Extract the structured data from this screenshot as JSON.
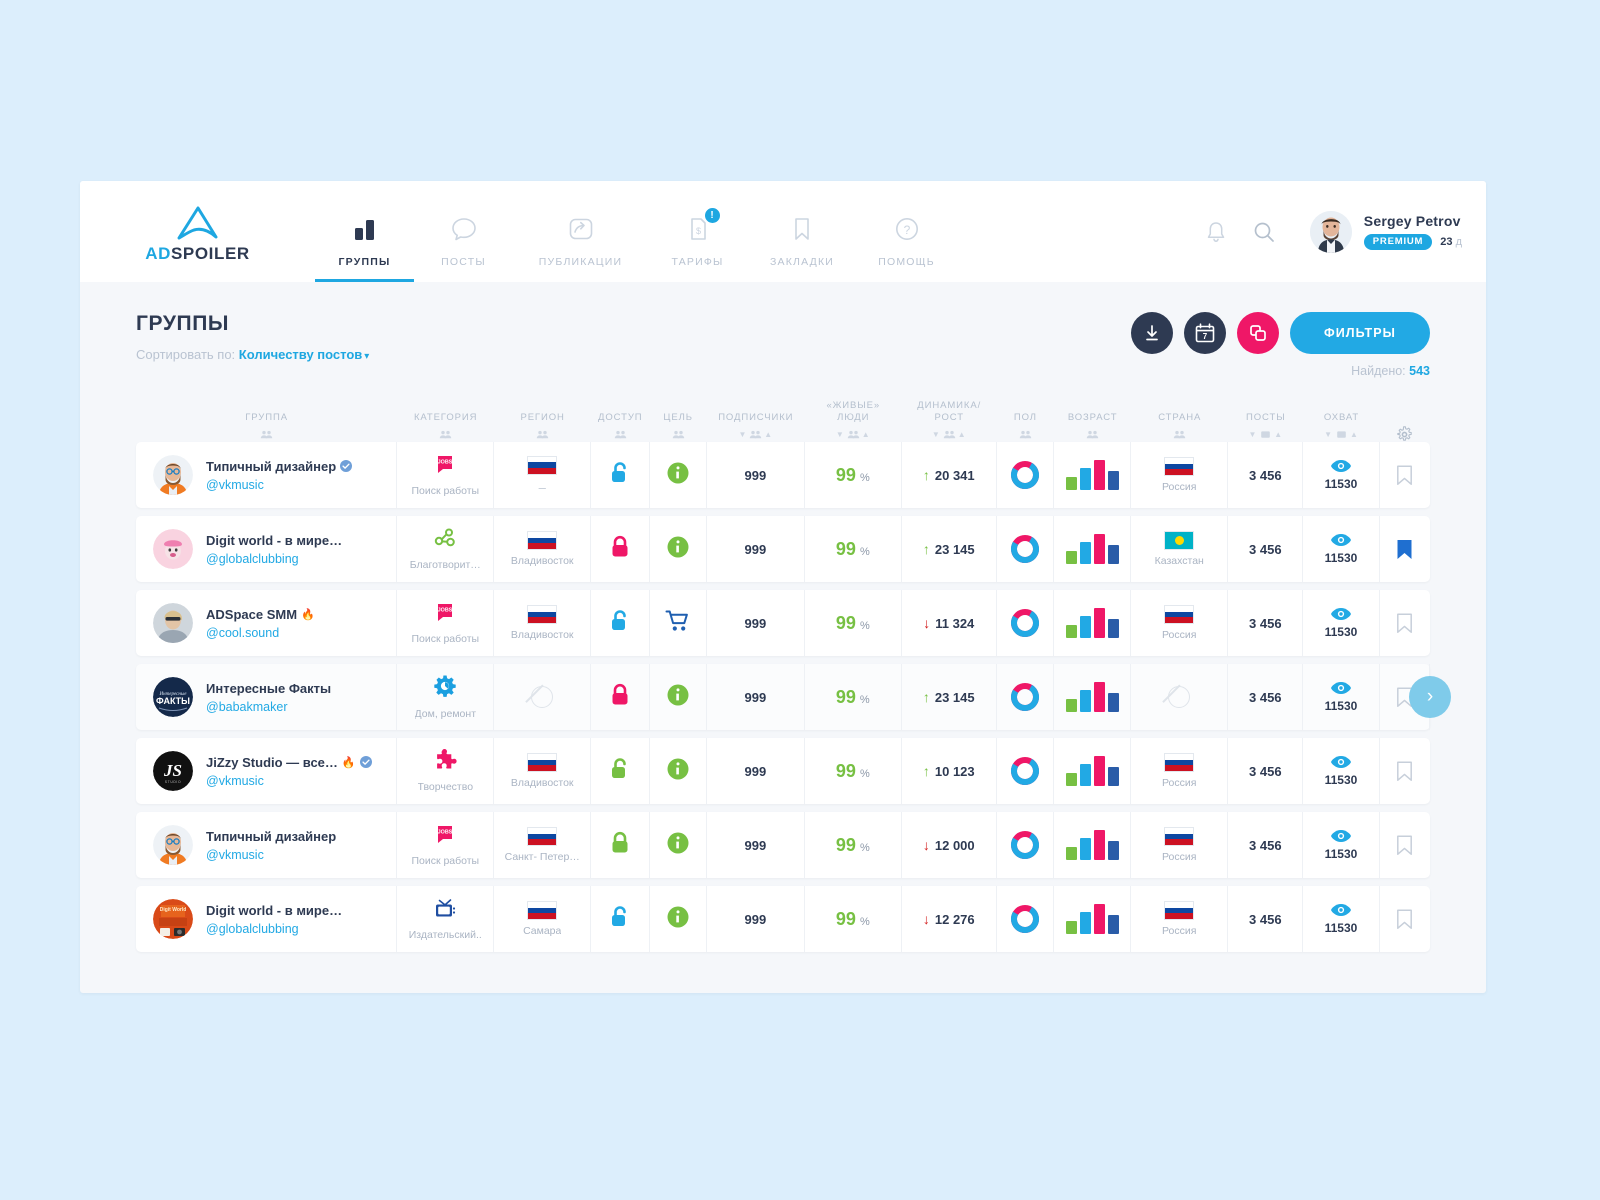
{
  "brand": {
    "ad": "AD",
    "spoiler": "SPOILER",
    "logo_color": "#1ea7e1",
    "text_color": "#2e3a52"
  },
  "nav": {
    "items": [
      {
        "label": "ГРУППЫ",
        "icon": "bar-chart-icon",
        "active": true,
        "badge": null
      },
      {
        "label": "ПОСТЫ",
        "icon": "comment-icon",
        "active": false,
        "badge": null
      },
      {
        "label": "ПУБЛИКАЦИИ",
        "icon": "share-icon",
        "active": false,
        "badge": null
      },
      {
        "label": "ТАРИФЫ",
        "icon": "price-doc-icon",
        "active": false,
        "badge": "!"
      },
      {
        "label": "ЗАКЛАДКИ",
        "icon": "bookmark-icon",
        "active": false,
        "badge": null
      },
      {
        "label": "ПОМОЩЬ",
        "icon": "question-icon",
        "active": false,
        "badge": null
      }
    ]
  },
  "header_actions": {
    "bell": "bell-icon",
    "search": "search-icon"
  },
  "user": {
    "name": "Sergey Petrov",
    "plan": "PREMIUM",
    "days_value": "23",
    "days_unit": "д"
  },
  "page": {
    "title": "ГРУППЫ",
    "sort_prefix": "Сортировать по:",
    "sort_value": "Количеству постов",
    "found_label": "Найдено:",
    "found_value": "543",
    "filters_button": "ФИЛЬТРЫ",
    "calendar_day": "7"
  },
  "table": {
    "columns": [
      {
        "label": "ГРУППА",
        "sub": "people"
      },
      {
        "label": "КАТЕГОРИЯ",
        "sub": "people"
      },
      {
        "label": "РЕГИОН",
        "sub": "people"
      },
      {
        "label": "ДОСТУП",
        "sub": "people"
      },
      {
        "label": "ЦЕЛЬ",
        "sub": "people"
      },
      {
        "label": "ПОДПИСЧИКИ",
        "sub": "people-sort"
      },
      {
        "label": "«ЖИВЫЕ»\nЛЮДИ",
        "sub": "people-sort"
      },
      {
        "label": "ДИНАМИКА/\nРОСТ",
        "sub": "people-sort"
      },
      {
        "label": "ПОЛ",
        "sub": "people"
      },
      {
        "label": "ВОЗРАСТ",
        "sub": "people"
      },
      {
        "label": "СТРАНА",
        "sub": "people"
      },
      {
        "label": "ПОСТЫ",
        "sub": "doc-sort"
      },
      {
        "label": "ОХВАТ",
        "sub": "doc-sort"
      },
      {
        "label": "",
        "sub": "gear"
      }
    ],
    "rows": [
      {
        "name": "Типичный дизайнер",
        "handle": "@vkmusic",
        "verified": true,
        "fire": false,
        "avatar": "designer",
        "category": "Поиск работы",
        "category_icon": "jobs-icon",
        "region": "–",
        "region_flag": "ru",
        "region_is_dash": true,
        "access": "open",
        "access_color": "#22a9e4",
        "goal": "info",
        "subscribers": "999",
        "live_value": "99",
        "live_unit": "%",
        "dynamics_value": "20 341",
        "dynamics_dir": "up",
        "gender_male": 75,
        "gender_female": 25,
        "age": [
          13,
          22,
          30,
          19
        ],
        "country": "Россия",
        "country_flag": "ru",
        "posts": "3 456",
        "reach": "11530",
        "bookmarked": false,
        "next_arrow": false
      },
      {
        "name": "Digit world - в мире…",
        "handle": "@globalclubbing",
        "verified": false,
        "fire": false,
        "avatar": "pink",
        "category": "Благотворит…",
        "category_icon": "molecule-icon",
        "region": "Владивосток",
        "region_flag": "ru",
        "region_is_dash": false,
        "access": "closed",
        "access_color": "#ef1767",
        "goal": "info",
        "subscribers": "999",
        "live_value": "99",
        "live_unit": "%",
        "dynamics_value": "23 145",
        "dynamics_dir": "up",
        "gender_male": 75,
        "gender_female": 25,
        "age": [
          13,
          22,
          30,
          19
        ],
        "country": "Казахстан",
        "country_flag": "kz",
        "posts": "3 456",
        "reach": "11530",
        "bookmarked": true,
        "next_arrow": false
      },
      {
        "name": "ADSpace SMM",
        "handle": "@cool.sound",
        "verified": false,
        "fire": true,
        "avatar": "photo",
        "category": "Поиск работы",
        "category_icon": "jobs-icon",
        "region": "Владивосток",
        "region_flag": "ru",
        "region_is_dash": false,
        "access": "open",
        "access_color": "#22a9e4",
        "goal": "cart",
        "subscribers": "999",
        "live_value": "99",
        "live_unit": "%",
        "dynamics_value": "11 324",
        "dynamics_dir": "down",
        "gender_male": 75,
        "gender_female": 25,
        "age": [
          13,
          22,
          30,
          19
        ],
        "country": "Россия",
        "country_flag": "ru",
        "posts": "3 456",
        "reach": "11530",
        "bookmarked": false,
        "next_arrow": false
      },
      {
        "name": "Интересные Факты",
        "handle": "@babakmaker",
        "verified": false,
        "fire": false,
        "avatar": "facts",
        "category": "Дом, ремонт",
        "category_icon": "gear-blue-icon",
        "region": "",
        "region_flag": "none",
        "region_is_dash": false,
        "access": "closed",
        "access_color": "#ef1767",
        "goal": "info",
        "subscribers": "999",
        "live_value": "99",
        "live_unit": "%",
        "dynamics_value": "23 145",
        "dynamics_dir": "up",
        "gender_male": 75,
        "gender_female": 25,
        "age": [
          13,
          22,
          30,
          19
        ],
        "country": "",
        "country_flag": "none",
        "posts": "3 456",
        "reach": "11530",
        "bookmarked": false,
        "next_arrow": true
      },
      {
        "name": "JiZzy Studio — все…",
        "handle": "@vkmusic",
        "verified": true,
        "fire": true,
        "avatar": "js",
        "category": "Творчество",
        "category_icon": "puzzle-icon",
        "region": "Владивосток",
        "region_flag": "ru",
        "region_is_dash": false,
        "access": "open",
        "access_color": "#77c043",
        "goal": "info",
        "subscribers": "999",
        "live_value": "99",
        "live_unit": "%",
        "dynamics_value": "10 123",
        "dynamics_dir": "up",
        "gender_male": 75,
        "gender_female": 25,
        "age": [
          13,
          22,
          30,
          19
        ],
        "country": "Россия",
        "country_flag": "ru",
        "posts": "3 456",
        "reach": "11530",
        "bookmarked": false,
        "next_arrow": false
      },
      {
        "name": "Типичный дизайнер",
        "handle": "@vkmusic",
        "verified": false,
        "fire": false,
        "avatar": "designer",
        "category": "Поиск работы",
        "category_icon": "jobs-icon",
        "region": "Санкт- Петер…",
        "region_flag": "ru",
        "region_is_dash": false,
        "access": "closed",
        "access_color": "#77c043",
        "goal": "info",
        "subscribers": "999",
        "live_value": "99",
        "live_unit": "%",
        "dynamics_value": "12 000",
        "dynamics_dir": "down",
        "gender_male": 75,
        "gender_female": 25,
        "age": [
          13,
          22,
          30,
          19
        ],
        "country": "Россия",
        "country_flag": "ru",
        "posts": "3 456",
        "reach": "11530",
        "bookmarked": false,
        "next_arrow": false
      },
      {
        "name": "Digit world - в мире…",
        "handle": "@globalclubbing",
        "verified": false,
        "fire": false,
        "avatar": "collage",
        "category": "Издательский..",
        "category_icon": "tv-icon",
        "region": "Самара",
        "region_flag": "ru",
        "region_is_dash": false,
        "access": "open",
        "access_color": "#22a9e4",
        "goal": "info",
        "subscribers": "999",
        "live_value": "99",
        "live_unit": "%",
        "dynamics_value": "12 276",
        "dynamics_dir": "down",
        "gender_male": 75,
        "gender_female": 25,
        "age": [
          13,
          22,
          30,
          19
        ],
        "country": "Россия",
        "country_flag": "ru",
        "posts": "3 456",
        "reach": "11530",
        "bookmarked": false,
        "next_arrow": false
      }
    ]
  },
  "colors": {
    "accent": "#22a9e4",
    "pink": "#ef1767",
    "green": "#77c043",
    "navy": "#2e3a52",
    "muted": "#b9c3d1",
    "page_bg": "#f5f7fa",
    "canvas": "#dceefc"
  }
}
